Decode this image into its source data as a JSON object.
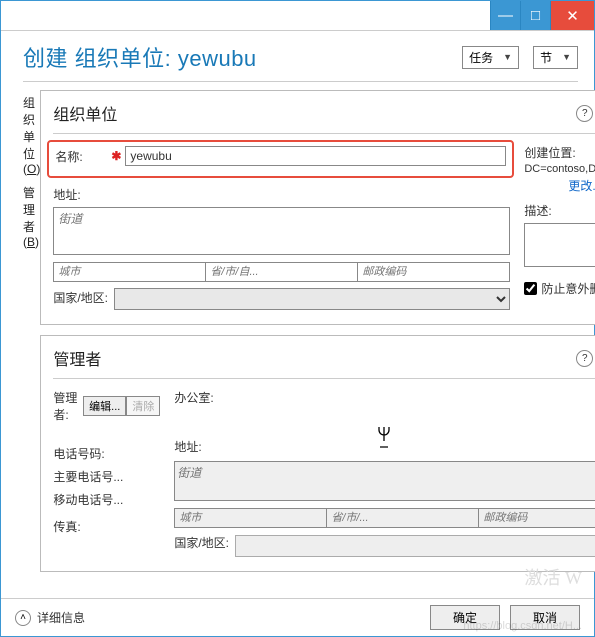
{
  "titlebar": {
    "min": "—",
    "max": "□",
    "close": "✕"
  },
  "header": {
    "title": "创建 组织单位: yewubu",
    "tasks": "任务",
    "sections": "节"
  },
  "leftnav": {
    "item1": {
      "label": "组织单位(",
      "accel": "O",
      "tail": ")"
    },
    "item2": {
      "label": "管理者(",
      "accel": "B",
      "tail": ")"
    }
  },
  "ou_panel": {
    "title": "组织单位",
    "name_label": "名称:",
    "name_value": "yewubu",
    "addr_label": "地址:",
    "street_ph": "街道",
    "city_ph": "城市",
    "state_ph": "省/市/自...",
    "zip_ph": "邮政编码",
    "country_label": "国家/地区:",
    "loc_label": "创建位置:",
    "loc_value": "DC=contoso,DC=com",
    "change": "更改...",
    "desc_label": "描述:",
    "protect_label": "防止意外删除"
  },
  "mgr_panel": {
    "title": "管理者",
    "mgr_label": "管理者:",
    "edit": "编辑...",
    "clear": "清除",
    "phone_label": "电话号码:",
    "main_phone": "主要电话号...",
    "mobile": "移动电话号...",
    "fax": "传真:",
    "office_label": "办公室:",
    "addr_label": "地址:",
    "street_ph": "街道",
    "city_ph": "城市",
    "state_ph": "省/市/...",
    "zip_ph": "邮政编码",
    "country_label": "国家/地区:"
  },
  "footer": {
    "details": "详细信息",
    "ok": "确定",
    "cancel": "取消"
  },
  "watermark": "激活 W",
  "watermark2": "https://blog.csdn.net/H..."
}
